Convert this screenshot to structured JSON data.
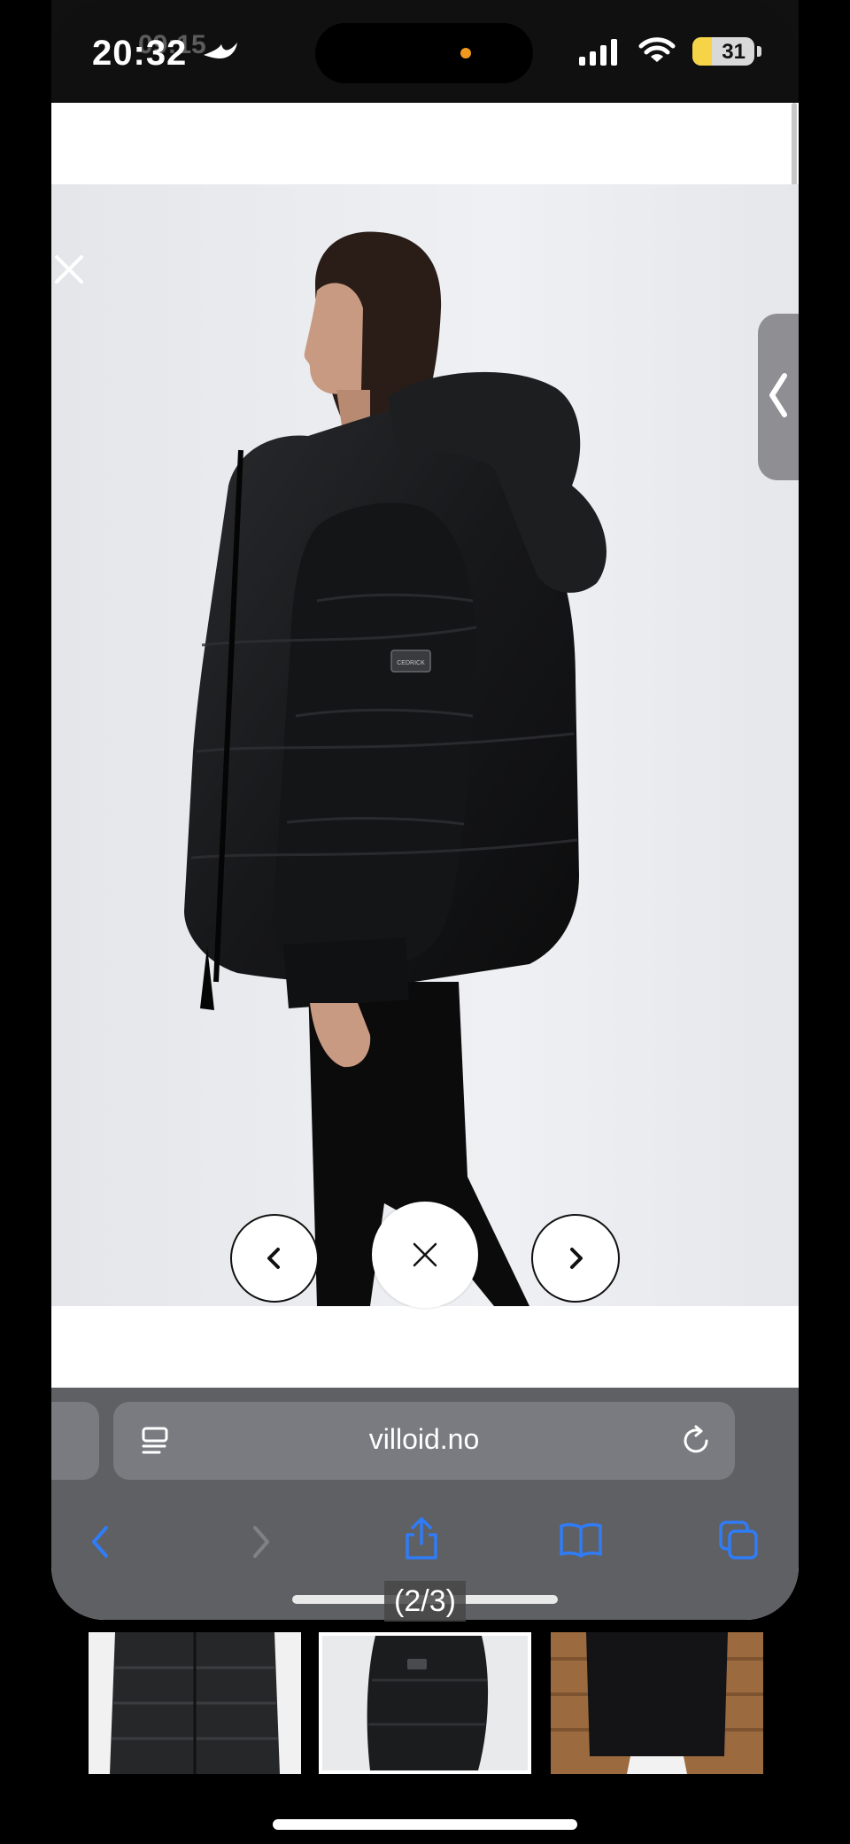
{
  "status_bar": {
    "time": "20:32",
    "ghost_time": "09:15",
    "battery": "31",
    "battery_level_percent": 31
  },
  "browser": {
    "url": "villoid.no",
    "reader_icon": "reader-mode-icon",
    "reload_icon": "reload-icon"
  },
  "toolbar": {
    "back": "chevron-left-icon",
    "forward": "chevron-right-icon",
    "share": "share-icon",
    "bookmarks": "book-icon",
    "tabs": "tabs-icon"
  },
  "lightbox": {
    "counter": "(2/3)",
    "brand_badge": "CEDRICK"
  },
  "colors": {
    "ios_blue": "#2f7cf6",
    "safari_bar": "#5f6064",
    "url_field": "#7a7b80"
  }
}
